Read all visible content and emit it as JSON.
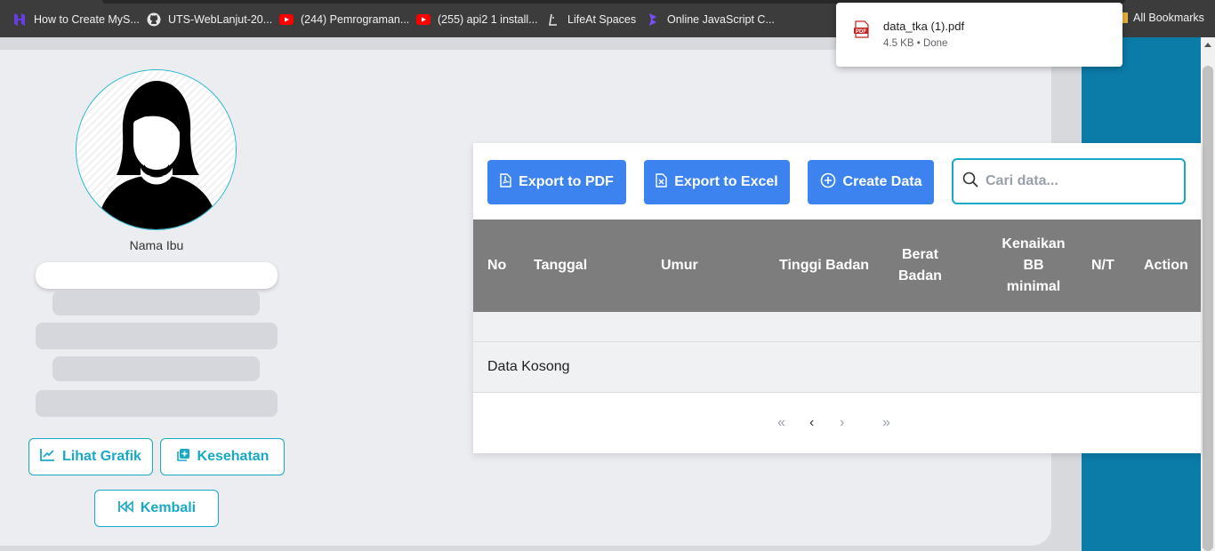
{
  "bookmarks": [
    {
      "label": "How to Create MyS...",
      "icon": "hostinger-icon"
    },
    {
      "label": "UTS-WebLanjut-20...",
      "icon": "github-icon"
    },
    {
      "label": "(244) Pemrograman...",
      "icon": "youtube-icon"
    },
    {
      "label": "(255) api2 1 install...",
      "icon": "youtube-icon"
    },
    {
      "label": "LifeAt Spaces",
      "icon": "lifeat-icon"
    },
    {
      "label": "Online JavaScript C...",
      "icon": "playcode-icon"
    }
  ],
  "all_bookmarks_label": "All Bookmarks",
  "download": {
    "filename": "data_tka (1).pdf",
    "meta": "4.5 KB • Done",
    "icon": "pdf-file-icon"
  },
  "profile": {
    "name_label": "Nama Ibu",
    "avatar_icon": "female-avatar-icon"
  },
  "actions": {
    "grafik_label": "Lihat Grafik",
    "kesehatan_label": "Kesehatan",
    "kembali_label": "Kembali"
  },
  "toolbar": {
    "export_pdf_label": "Export to PDF",
    "export_excel_label": "Export to Excel",
    "create_label": "Create Data",
    "search_placeholder": "Cari data..."
  },
  "table": {
    "columns": {
      "no": "No",
      "tanggal": "Tanggal",
      "umur": "Umur",
      "tinggi": "Tinggi Badan",
      "berat_1": "Berat",
      "berat_2": "Badan",
      "kenaikan_1": "Kenaikan",
      "kenaikan_2": "BB",
      "kenaikan_3": "minimal",
      "nt": "N/T",
      "action": "Action"
    },
    "empty_text": "Data Kosong"
  },
  "pagination": {
    "first": "«",
    "prev": "‹",
    "next": "›",
    "last": "»"
  },
  "colors": {
    "primary": "#3c83f0",
    "accent": "#17a9c6",
    "header_bg": "#7d7d7d",
    "side_panel": "#0b7ba7"
  }
}
